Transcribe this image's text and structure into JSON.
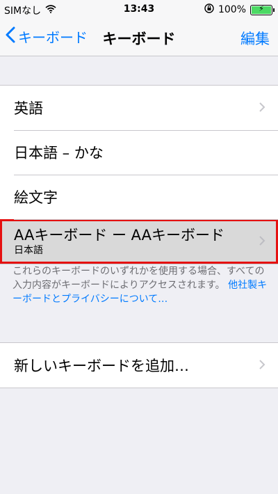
{
  "status": {
    "carrier": "SIMなし",
    "time": "13:43",
    "battery": "100%"
  },
  "nav": {
    "back_label": "キーボード",
    "title": "キーボード",
    "edit_label": "編集"
  },
  "keyboards": [
    {
      "label": "英語"
    },
    {
      "label": "日本語 – かな"
    },
    {
      "label": "絵文字"
    },
    {
      "label": "AAキーボード ー AAキーボード",
      "sublabel": "日本語"
    }
  ],
  "note": {
    "text": "これらのキーボードのいずれかを使用する場合、すべての入力内容がキーボードによりアクセスされます。",
    "link": "他社製キーボードとプライバシーについて…"
  },
  "add_keyboard": {
    "label": "新しいキーボードを追加…"
  },
  "colors": {
    "accent": "#007aff",
    "highlight_border": "#e51010",
    "battery_fill": "#4cd964"
  },
  "icons": [
    "wifi-icon",
    "orientation-lock-icon",
    "battery-icon",
    "back-chevron-icon",
    "chevron-right-icon"
  ]
}
